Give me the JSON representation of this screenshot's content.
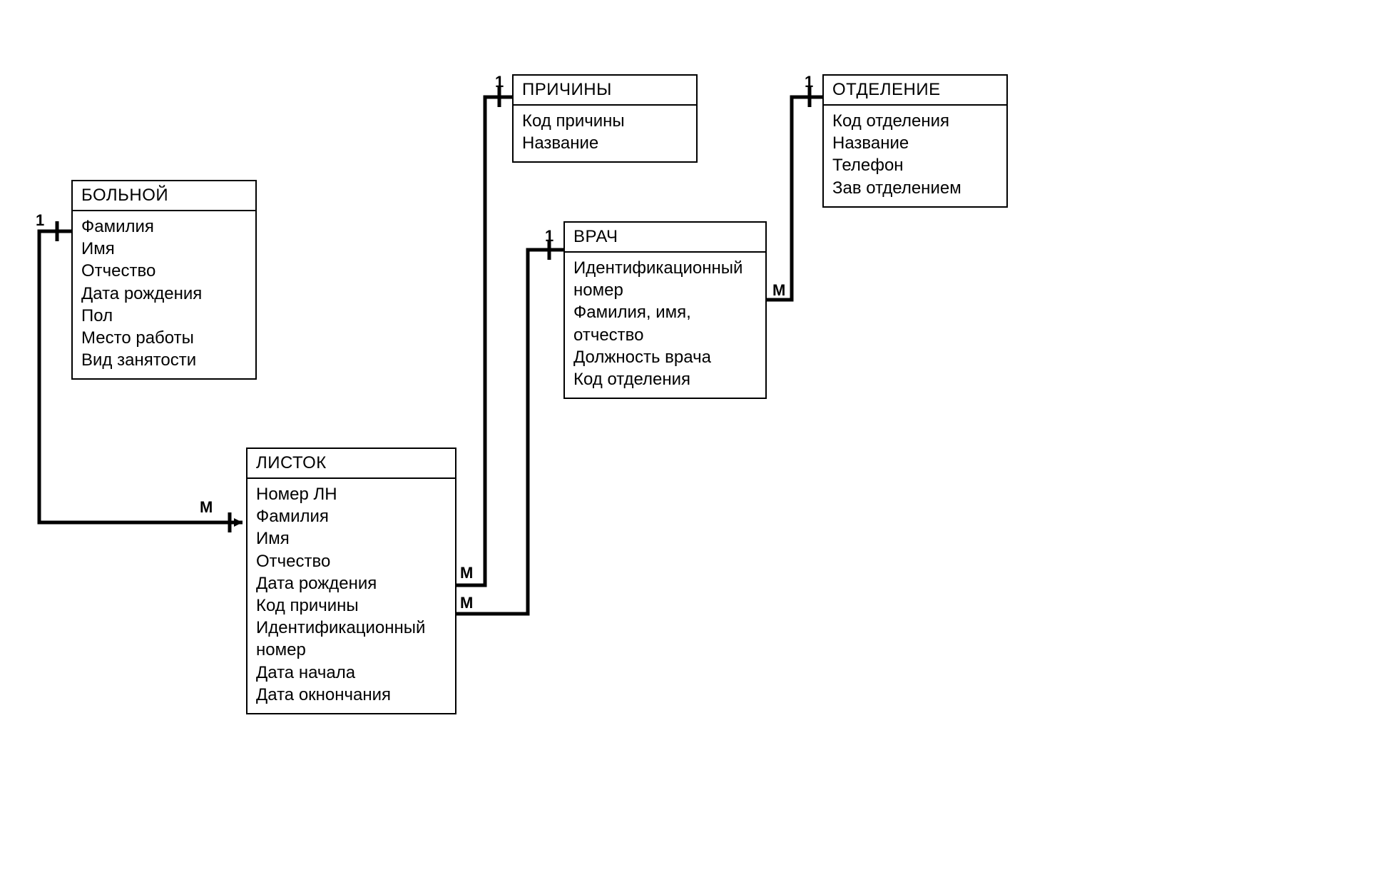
{
  "entities": {
    "patient": {
      "title": "БОЛЬНОЙ",
      "attrs": [
        "Фамилия",
        "Имя",
        "Отчество",
        "Дата рождения",
        "Пол",
        "Место работы",
        "Вид занятости"
      ]
    },
    "sheet": {
      "title": "ЛИСТОК",
      "attrs": [
        "Номер ЛН",
        "Фамилия",
        "Имя",
        "Отчество",
        "Дата рождения",
        "Код причины",
        "Идентификационный номер",
        "Дата начала",
        "Дата окнончания"
      ]
    },
    "reasons": {
      "title": "ПРИЧИНЫ",
      "attrs": [
        "Код причины",
        "Название"
      ]
    },
    "doctor": {
      "title": "ВРАЧ",
      "attrs": [
        "Идентификационный номер",
        "Фамилия, имя, отчество",
        "Должность врача",
        "Код отделения"
      ]
    },
    "department": {
      "title": "ОТДЕЛЕНИЕ",
      "attrs": [
        "Код отделения",
        "Название",
        "Телефон",
        "Зав отделением"
      ]
    }
  },
  "cardinalities": {
    "patient_one": "1",
    "sheet_from_patient_many": "M",
    "reasons_one": "1",
    "sheet_from_reasons_many": "M",
    "doctor_one": "1",
    "sheet_from_doctor_many": "M",
    "department_one": "1",
    "doctor_from_department_many": "M"
  }
}
